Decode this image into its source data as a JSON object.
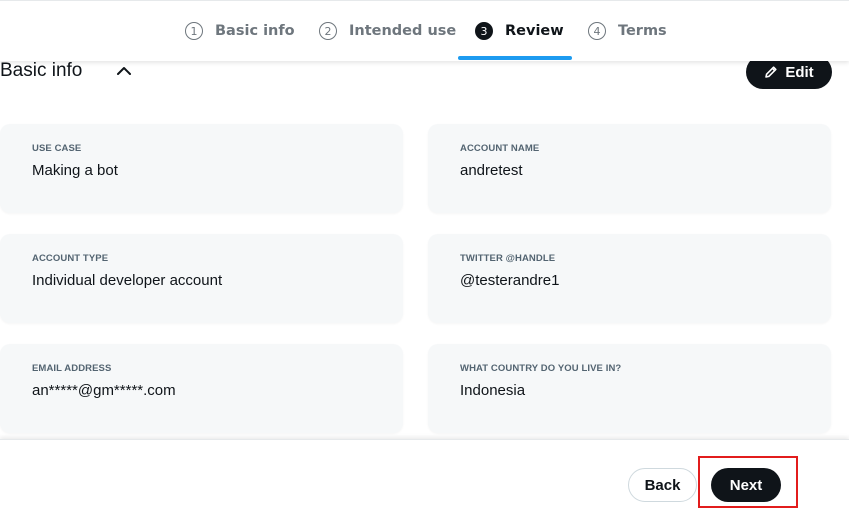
{
  "stepper": {
    "steps": [
      {
        "number": "1",
        "label": "Basic info"
      },
      {
        "number": "2",
        "label": "Intended use"
      },
      {
        "number": "3",
        "label": "Review"
      },
      {
        "number": "4",
        "label": "Terms"
      }
    ],
    "active_step": 3,
    "accent_color": "#1d9bf0"
  },
  "section": {
    "title": "Basic info",
    "collapse_icon": "chevron-up-icon",
    "edit_label": "Edit",
    "edit_icon": "pencil-icon"
  },
  "fields": [
    {
      "label": "USE CASE",
      "value": "Making a bot"
    },
    {
      "label": "ACCOUNT NAME",
      "value": "andretest"
    },
    {
      "label": "ACCOUNT TYPE",
      "value": "Individual developer account"
    },
    {
      "label": "TWITTER @HANDLE",
      "value": "@testerandre1"
    },
    {
      "label": "EMAIL ADDRESS",
      "value": "an*****@gm*****.com"
    },
    {
      "label": "WHAT COUNTRY DO YOU LIVE IN?",
      "value": "Indonesia"
    }
  ],
  "footer": {
    "back_label": "Back",
    "next_label": "Next",
    "highlight_color": "#e21c1c"
  }
}
